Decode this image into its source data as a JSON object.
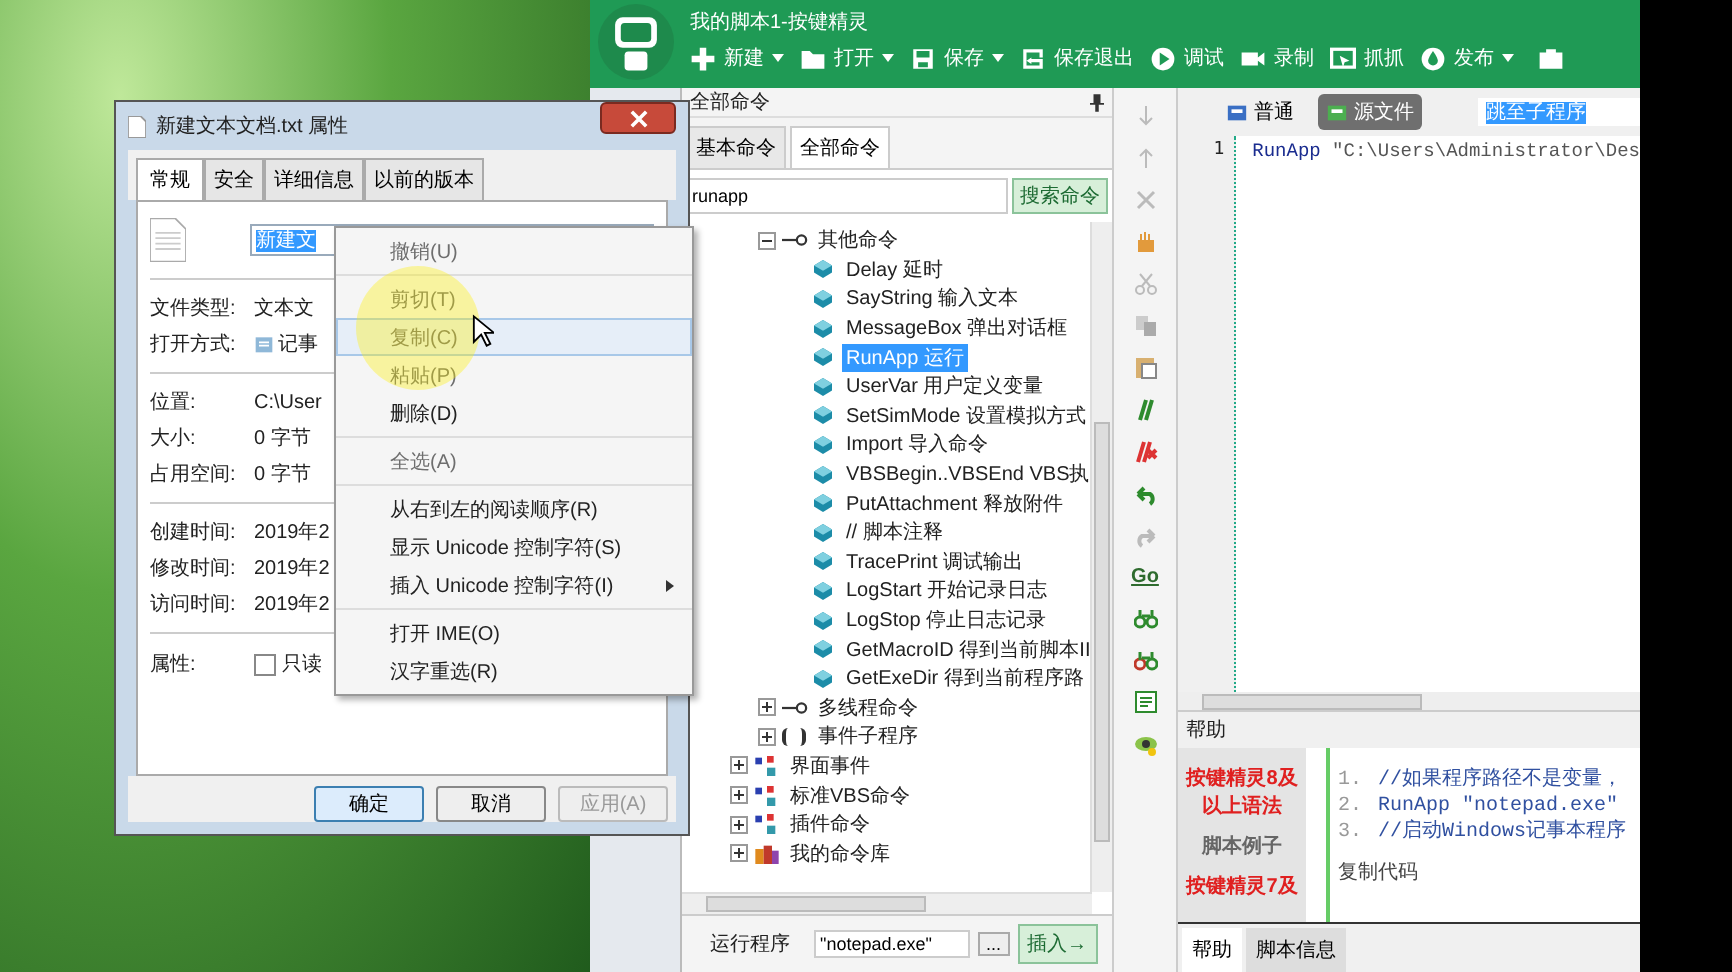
{
  "app": {
    "title": "我的脚本1-按键精灵",
    "toolbar": [
      {
        "label": "新建",
        "kind": "plus",
        "dropdown": true
      },
      {
        "label": "打开",
        "kind": "folder",
        "dropdown": true
      },
      {
        "label": "保存",
        "kind": "disk",
        "dropdown": true
      },
      {
        "label": "保存退出",
        "kind": "disk-exit",
        "dropdown": false
      },
      {
        "label": "调试",
        "kind": "play",
        "dropdown": false
      },
      {
        "label": "录制",
        "kind": "camera",
        "dropdown": false
      },
      {
        "label": "抓抓",
        "kind": "capture",
        "dropdown": false
      },
      {
        "label": "发布",
        "kind": "drop",
        "dropdown": true
      }
    ]
  },
  "command_panel": {
    "title": "全部命令",
    "tabs": [
      {
        "label": "基本命令",
        "selected": false
      },
      {
        "label": "全部命令",
        "selected": true
      }
    ],
    "search": {
      "value": "runapp"
    },
    "search_button": "搜索命令",
    "tree": {
      "continued_children": [
        {
          "label": "其他命令",
          "kind": "group",
          "expanded": true,
          "children": [
            {
              "label": "Delay 延时",
              "selected": false
            },
            {
              "label": "SayString 输入文本",
              "selected": false
            },
            {
              "label": "MessageBox 弹出对话框",
              "selected": false
            },
            {
              "label": "RunApp 运行",
              "selected": true
            },
            {
              "label": "UserVar 用户定义变量",
              "selected": false
            },
            {
              "label": "SetSimMode 设置模拟方式",
              "selected": false
            },
            {
              "label": "Import 导入命令",
              "selected": false
            },
            {
              "label": "VBSBegin..VBSEnd VBS执",
              "selected": false
            },
            {
              "label": "PutAttachment 释放附件",
              "selected": false
            },
            {
              "label": "// 脚本注释",
              "selected": false
            },
            {
              "label": "TracePrint 调试输出",
              "selected": false
            },
            {
              "label": "LogStart 开始记录日志",
              "selected": false
            },
            {
              "label": "LogStop 停止日志记录",
              "selected": false
            },
            {
              "label": "GetMacroID 得到当前脚本II",
              "selected": false
            },
            {
              "label": "GetExeDir 得到当前程序路",
              "selected": false
            }
          ]
        },
        {
          "label": "多线程命令",
          "kind": "group",
          "expanded": false
        },
        {
          "label": "事件子程序",
          "kind": "event",
          "expanded": false
        }
      ],
      "roots": [
        {
          "label": "界面事件",
          "kind": "category",
          "expanded": false
        },
        {
          "label": "标准VBS命令",
          "kind": "category",
          "expanded": false
        },
        {
          "label": "插件命令",
          "kind": "category",
          "expanded": false
        },
        {
          "label": "我的命令库",
          "kind": "library",
          "expanded": false
        }
      ]
    },
    "run_label": "运行程序",
    "run_value": "\"notepad.exe\"",
    "browse_button": "...",
    "insert_button": "插入→"
  },
  "tool_column": {
    "go_label": "Go"
  },
  "editor": {
    "view_tabs": [
      {
        "label": "普通",
        "selected": false
      },
      {
        "label": "源文件",
        "selected": true
      }
    ],
    "subroutine_field": "跳至子程序",
    "lines": [
      {
        "number": "1",
        "keyword": "RunApp",
        "text": "\"C:\\Users\\Administrator\\Des"
      }
    ]
  },
  "help": {
    "title": "帮助",
    "sidebar": [
      {
        "text": "按键精灵8及以上语法",
        "kind": "version"
      },
      {
        "text": "脚本例子",
        "kind": "heading"
      },
      {
        "text": "按键精灵7及",
        "kind": "version"
      }
    ],
    "code_lines": [
      {
        "number": "1.",
        "text": "//如果程序路径不是变量，"
      },
      {
        "number": "2.",
        "text": "RunApp \"notepad.exe\""
      },
      {
        "number": "3.",
        "text": "//启动Windows记事本程序"
      }
    ],
    "copy_link": "复制代码",
    "tabs": [
      {
        "label": "帮助",
        "selected": true
      },
      {
        "label": "脚本信息",
        "selected": false
      }
    ]
  },
  "dialog": {
    "title": "新建文本文档.txt 属性",
    "tabs": [
      {
        "label": "常规",
        "selected": true
      },
      {
        "label": "安全",
        "selected": false
      },
      {
        "label": "详细信息",
        "selected": false
      },
      {
        "label": "以前的版本",
        "selected": false
      }
    ],
    "name_field": "新建文",
    "groups": [
      [
        {
          "label": "文件类型:",
          "value": "文本文",
          "kind": "text"
        },
        {
          "label": "打开方式:",
          "value": "记事",
          "kind": "app"
        }
      ],
      [
        {
          "label": "位置:",
          "value": "C:\\User",
          "kind": "text"
        },
        {
          "label": "大小:",
          "value": "0 字节",
          "kind": "text"
        },
        {
          "label": "占用空间:",
          "value": "0 字节",
          "kind": "text"
        }
      ],
      [
        {
          "label": "创建时间:",
          "value": "2019年2",
          "kind": "text"
        },
        {
          "label": "修改时间:",
          "value": "2019年2",
          "kind": "text"
        },
        {
          "label": "访问时间:",
          "value": "2019年2",
          "kind": "text"
        }
      ]
    ],
    "attributes": {
      "label": "属性:",
      "readonly_label": "只读",
      "readonly_checked": false
    },
    "buttons": [
      {
        "label": "确定",
        "default": true,
        "disabled": false
      },
      {
        "label": "取消",
        "default": false,
        "disabled": false
      },
      {
        "label": "应用(A)",
        "default": false,
        "disabled": true
      }
    ]
  },
  "context_menu": {
    "groups": [
      [
        {
          "label": "撤销(U)",
          "disabled": true,
          "hovered": false,
          "submenu": false
        }
      ],
      [
        {
          "label": "剪切(T)",
          "disabled": true,
          "hovered": false,
          "submenu": false
        },
        {
          "label": "复制(C)",
          "disabled": true,
          "hovered": true,
          "submenu": false
        },
        {
          "label": "粘贴(P)",
          "disabled": true,
          "hovered": false,
          "submenu": false
        },
        {
          "label": "删除(D)",
          "disabled": false,
          "hovered": false,
          "submenu": false
        }
      ],
      [
        {
          "label": "全选(A)",
          "disabled": true,
          "hovered": false,
          "submenu": false
        }
      ],
      [
        {
          "label": "从右到左的阅读顺序(R)",
          "disabled": false,
          "hovered": false,
          "submenu": false
        },
        {
          "label": "显示 Unicode 控制字符(S)",
          "disabled": false,
          "hovered": false,
          "submenu": false
        },
        {
          "label": "插入 Unicode 控制字符(I)",
          "disabled": false,
          "hovered": false,
          "submenu": true
        }
      ],
      [
        {
          "label": "打开 IME(O)",
          "disabled": false,
          "hovered": false,
          "submenu": false
        },
        {
          "label": "汉字重选(R)",
          "disabled": false,
          "hovered": false,
          "submenu": false
        }
      ]
    ]
  }
}
